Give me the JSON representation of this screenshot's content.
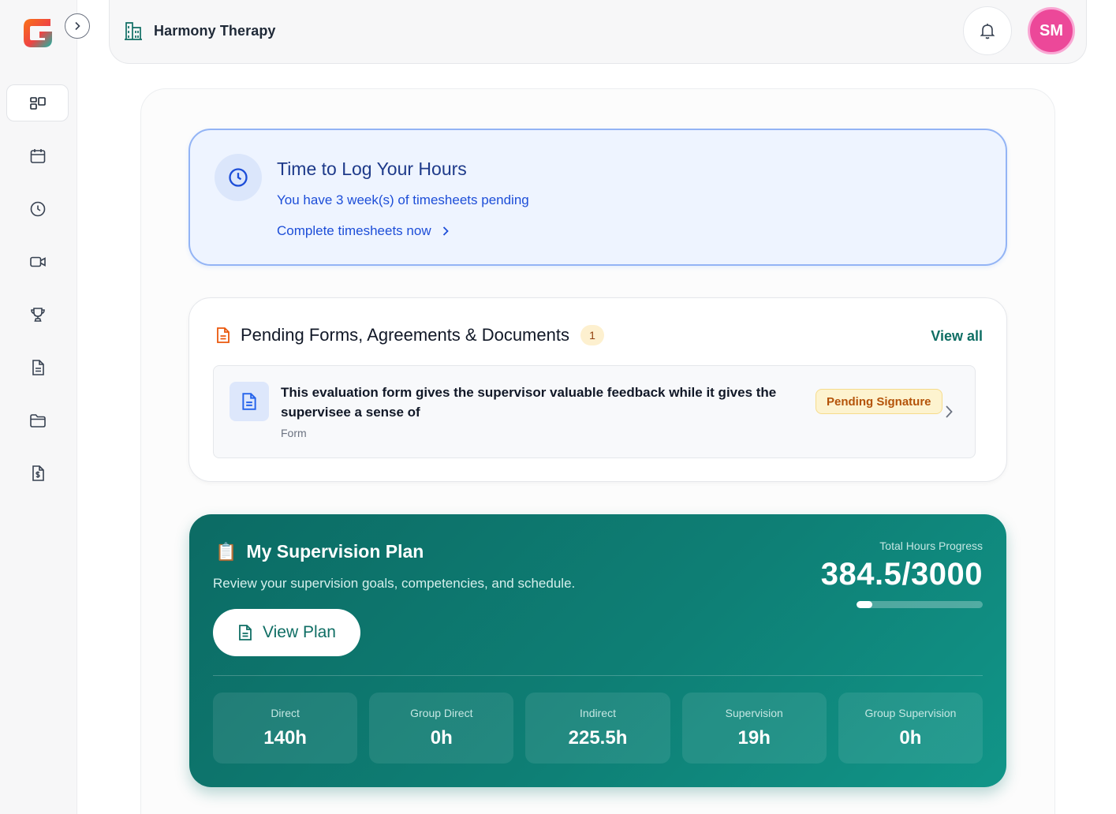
{
  "header": {
    "org_name": "Harmony Therapy",
    "avatar_initials": "SM"
  },
  "sidebar": {
    "items": [
      {
        "icon": "dashboard-icon",
        "active": true
      },
      {
        "icon": "calendar-icon",
        "active": false
      },
      {
        "icon": "clock-icon",
        "active": false
      },
      {
        "icon": "video-icon",
        "active": false
      },
      {
        "icon": "trophy-icon",
        "active": false
      },
      {
        "icon": "document-icon",
        "active": false
      },
      {
        "icon": "folder-icon",
        "active": false
      },
      {
        "icon": "invoice-icon",
        "active": false
      }
    ]
  },
  "timesheet_alert": {
    "title": "Time to Log Your Hours",
    "subtitle": "You have 3 week(s) of timesheets pending",
    "link_label": "Complete timesheets now"
  },
  "pending_forms": {
    "title": "Pending Forms, Agreements & Documents",
    "count": "1",
    "view_all_label": "View all",
    "items": [
      {
        "title": "This evaluation form gives the supervisor valuable feedback while it gives the supervisee a sense of",
        "type": "Form",
        "status": "Pending Signature"
      }
    ]
  },
  "supervision_plan": {
    "emoji": "📋",
    "title": "My Supervision Plan",
    "subtitle": "Review your supervision goals, competencies, and schedule.",
    "button_label": "View Plan",
    "progress_label": "Total Hours Progress",
    "progress_value": "384.5/3000",
    "progress_fraction": 0.128,
    "stats": [
      {
        "label": "Direct",
        "value": "140h"
      },
      {
        "label": "Group Direct",
        "value": "0h"
      },
      {
        "label": "Indirect",
        "value": "225.5h"
      },
      {
        "label": "Supervision",
        "value": "19h"
      },
      {
        "label": "Group Supervision",
        "value": "0h"
      }
    ]
  },
  "colors": {
    "brand_teal": "#0f766e",
    "alert_blue": "#1d4ed8",
    "avatar_pink": "#ec4899",
    "pending_amber": "#b45309"
  }
}
